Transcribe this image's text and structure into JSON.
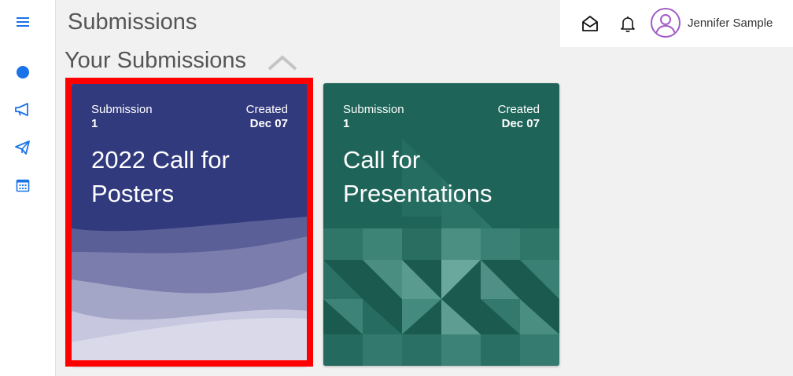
{
  "page": {
    "title": "Submissions"
  },
  "section": {
    "title": "Your Submissions"
  },
  "sidebar": {
    "items": [
      {
        "icon": "menu-icon"
      },
      {
        "icon": "circle-icon"
      },
      {
        "icon": "megaphone-icon"
      },
      {
        "icon": "paper-plane-icon"
      },
      {
        "icon": "calendar-icon"
      }
    ],
    "accent": "#1a73e8"
  },
  "user": {
    "name": "Jennifer Sample"
  },
  "cards": [
    {
      "submission_label": "Submission",
      "submission_number": "1",
      "created_label": "Created",
      "created_date": "Dec 07",
      "title": "2022 Call for Posters",
      "color": "#323a7e",
      "selected": true
    },
    {
      "submission_label": "Submission",
      "submission_number": "1",
      "created_label": "Created",
      "created_date": "Dec 07",
      "title": "Call for Presentations",
      "color": "#1e6458",
      "selected": false
    }
  ]
}
